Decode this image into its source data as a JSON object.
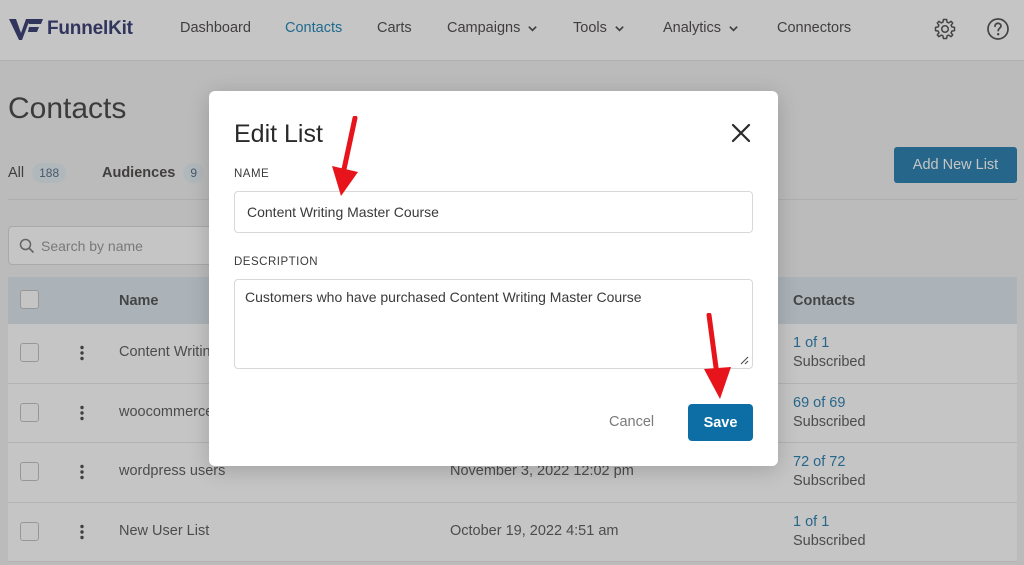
{
  "nav": {
    "brand": "FunnelKit",
    "items": [
      {
        "label": "Dashboard",
        "dropdown": false,
        "active": false
      },
      {
        "label": "Contacts",
        "dropdown": false,
        "active": true
      },
      {
        "label": "Carts",
        "dropdown": false,
        "active": false
      },
      {
        "label": "Campaigns",
        "dropdown": true,
        "active": false
      },
      {
        "label": "Tools",
        "dropdown": true,
        "active": false
      },
      {
        "label": "Analytics",
        "dropdown": true,
        "active": false
      },
      {
        "label": "Connectors",
        "dropdown": false,
        "active": false
      }
    ],
    "icons": [
      "gear-icon",
      "help-icon"
    ]
  },
  "page": {
    "title": "Contacts",
    "tabs": [
      {
        "label": "All",
        "count": "188"
      },
      {
        "label": "Audiences",
        "count": "9"
      }
    ],
    "add_button": "Add New List",
    "search_placeholder": "Search by name"
  },
  "table": {
    "columns": {
      "name": "Name",
      "contacts": "Contacts"
    },
    "rows": [
      {
        "name": "Content Writin",
        "date": "",
        "contacts": "1 of 1",
        "status": "Subscribed"
      },
      {
        "name": "woocommerce",
        "date": "",
        "contacts": "69 of 69",
        "status": "Subscribed"
      },
      {
        "name": "wordpress users",
        "date": "November 3, 2022 12:02 pm",
        "contacts": "72 of 72",
        "status": "Subscribed"
      },
      {
        "name": "New User List",
        "date": "October 19, 2022 4:51 am",
        "contacts": "1 of 1",
        "status": "Subscribed"
      }
    ]
  },
  "modal": {
    "title": "Edit List",
    "name_label": "NAME",
    "name_value": "Content Writing Master Course",
    "description_label": "DESCRIPTION",
    "description_value": "Customers who have purchased Content Writing Master Course",
    "cancel": "Cancel",
    "save": "Save"
  },
  "colors": {
    "accent": "#0c6ea5",
    "header_row": "#d9e4ec",
    "annotation_arrow": "#e8141b"
  }
}
